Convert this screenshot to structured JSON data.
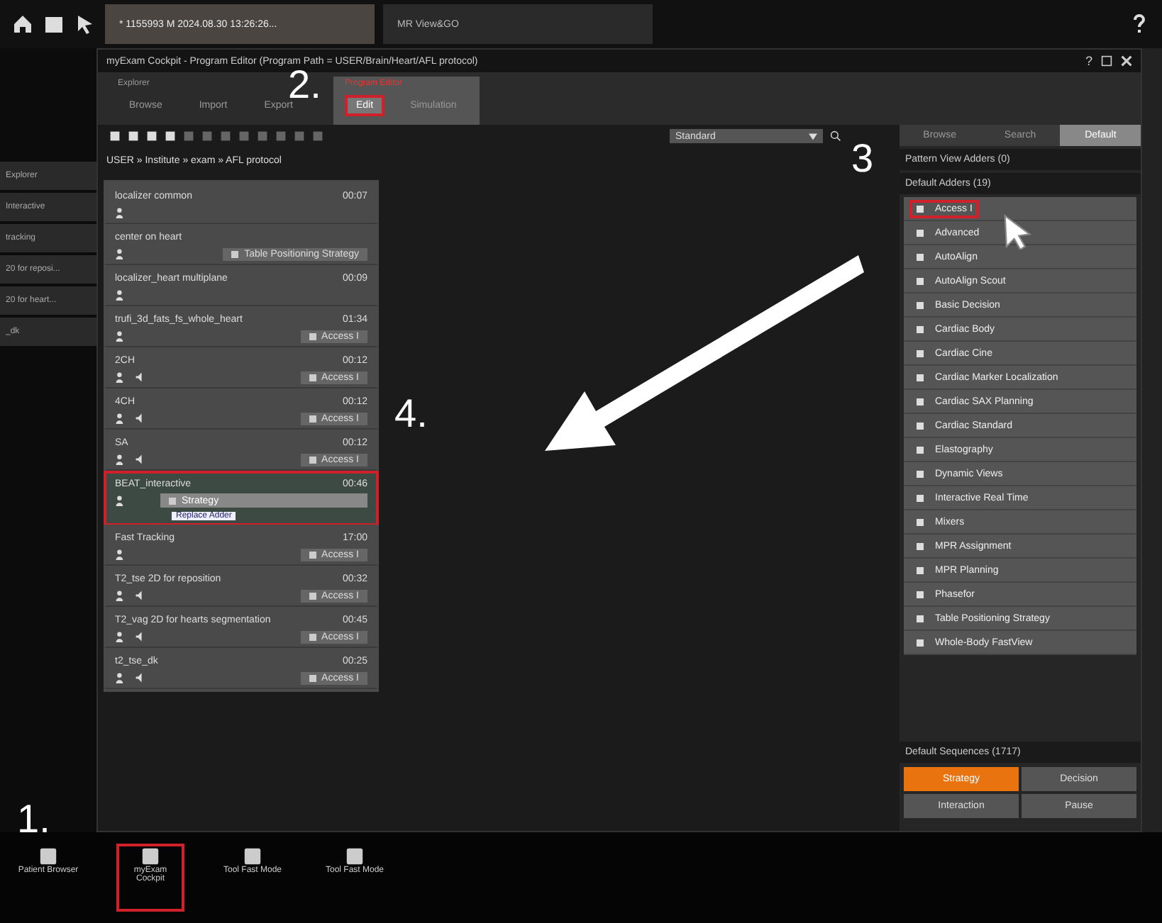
{
  "top_bar": {
    "tabs": [
      {
        "label": "* 1155993 M 2024.08.30 13:26:26...",
        "selected": true
      },
      {
        "label": "MR View&GO",
        "selected": false
      }
    ]
  },
  "left_strip": {
    "items": [
      {
        "label": "Explorer"
      },
      {
        "label": "Interactive"
      },
      {
        "label": "tracking"
      },
      {
        "label": "20 for reposi..."
      },
      {
        "label": "20 for heart..."
      },
      {
        "label": "_dk"
      }
    ]
  },
  "window": {
    "title": "myExam Cockpit - Program Editor (Program Path = USER/Brain/Heart/AFL protocol)",
    "help_label": "?",
    "tab_groups": [
      {
        "title": "Explorer",
        "selected": false,
        "tabs": [
          {
            "label": "Browse",
            "selected": false,
            "highlighted": false
          },
          {
            "label": "Import",
            "selected": false,
            "highlighted": false
          },
          {
            "label": "Export",
            "selected": false,
            "highlighted": false
          }
        ]
      },
      {
        "title": "Program Editor",
        "selected": true,
        "tabs": [
          {
            "label": "Edit",
            "selected": true,
            "highlighted": true
          },
          {
            "label": "Simulation",
            "selected": false,
            "highlighted": false
          }
        ]
      }
    ],
    "dropdown": {
      "value": "Standard"
    },
    "breadcrumb": "USER » Institute » exam » AFL protocol",
    "protocols": [
      {
        "name": "localizer common",
        "time": "00:07",
        "sound": false,
        "selected": false,
        "highlighted": false
      },
      {
        "name": "center on heart",
        "sound": false,
        "action": "Table Positioning Strategy",
        "selected": false,
        "highlighted": false
      },
      {
        "name": "localizer_heart multiplane",
        "time": "00:09",
        "sound": false,
        "selected": false,
        "highlighted": false
      },
      {
        "name": "trufi_3d_fats_fs_whole_heart",
        "time": "01:34",
        "sound": false,
        "action": "Access I",
        "selected": false,
        "highlighted": false
      },
      {
        "name": "2CH",
        "time": "00:12",
        "sound": true,
        "action": "Access I",
        "selected": false,
        "highlighted": false
      },
      {
        "name": "4CH",
        "time": "00:12",
        "sound": true,
        "action": "Access I",
        "selected": false,
        "highlighted": false
      },
      {
        "name": "SA",
        "time": "00:12",
        "sound": true,
        "action": "Access I",
        "selected": false,
        "highlighted": false
      },
      {
        "name": "BEAT_interactive",
        "time": "00:46",
        "sound": false,
        "selected": true,
        "highlighted": true
      },
      {
        "name": "Fast Tracking",
        "time": "17:00",
        "sound": false,
        "action": "Access I",
        "selected": false,
        "highlighted": false
      },
      {
        "name": "T2_tse 2D for reposition",
        "time": "00:32",
        "sound": true,
        "action": "Access I",
        "selected": false,
        "highlighted": false
      },
      {
        "name": "T2_vag 2D for hearts segmentation",
        "time": "00:45",
        "sound": true,
        "action": "Access I",
        "selected": false,
        "highlighted": false
      },
      {
        "name": "t2_tse_dk",
        "time": "00:25",
        "sound": true,
        "action": "Access I",
        "selected": false,
        "highlighted": false
      }
    ],
    "drag_item": {
      "label": "Strategy",
      "tooltip": "Replace Adder"
    },
    "side_panel": {
      "tabs": [
        {
          "label": "Browse",
          "selected": false
        },
        {
          "label": "Search",
          "selected": false
        },
        {
          "label": "Default",
          "selected": true
        }
      ],
      "pattern_header": "Pattern View Adders (0)",
      "adders_header": "Default Adders (19)",
      "adders": [
        {
          "label": "Access I",
          "highlighted": true
        },
        {
          "label": "Advanced",
          "highlighted": false
        },
        {
          "label": "AutoAlign",
          "highlighted": false
        },
        {
          "label": "AutoAlign Scout",
          "highlighted": false
        },
        {
          "label": "Basic Decision",
          "highlighted": false
        },
        {
          "label": "Cardiac Body",
          "highlighted": false
        },
        {
          "label": "Cardiac Cine",
          "highlighted": false
        },
        {
          "label": "Cardiac Marker Localization",
          "highlighted": false
        },
        {
          "label": "Cardiac SAX Planning",
          "highlighted": false
        },
        {
          "label": "Cardiac Standard",
          "highlighted": false
        },
        {
          "label": "Elastography",
          "highlighted": false
        },
        {
          "label": "Dynamic Views",
          "highlighted": false
        },
        {
          "label": "Interactive Real Time",
          "highlighted": false
        },
        {
          "label": "Mixers",
          "highlighted": false
        },
        {
          "label": "MPR Assignment",
          "highlighted": false
        },
        {
          "label": "MPR Planning",
          "highlighted": false
        },
        {
          "label": "Phasefor",
          "highlighted": false
        },
        {
          "label": "Table Positioning Strategy",
          "highlighted": false
        },
        {
          "label": "Whole-Body FastView",
          "highlighted": false
        }
      ],
      "sequences_header": "Default Sequences (1717)",
      "sequence_buttons": [
        {
          "label": "Strategy",
          "selected": true
        },
        {
          "label": "Decision",
          "selected": false
        },
        {
          "label": "Interaction",
          "selected": false
        },
        {
          "label": "Pause",
          "selected": false
        }
      ]
    }
  },
  "taskbar": [
    {
      "label": "Patient Browser",
      "highlighted": false
    },
    {
      "label": "myExam Cockpit",
      "highlighted": true
    },
    {
      "label": "Tool Fast Mode",
      "highlighted": false
    },
    {
      "label": "Tool Fast Mode",
      "highlighted": false
    }
  ],
  "annotations": [
    {
      "label": "1."
    },
    {
      "label": "2."
    },
    {
      "label": "3"
    },
    {
      "label": "4."
    }
  ]
}
